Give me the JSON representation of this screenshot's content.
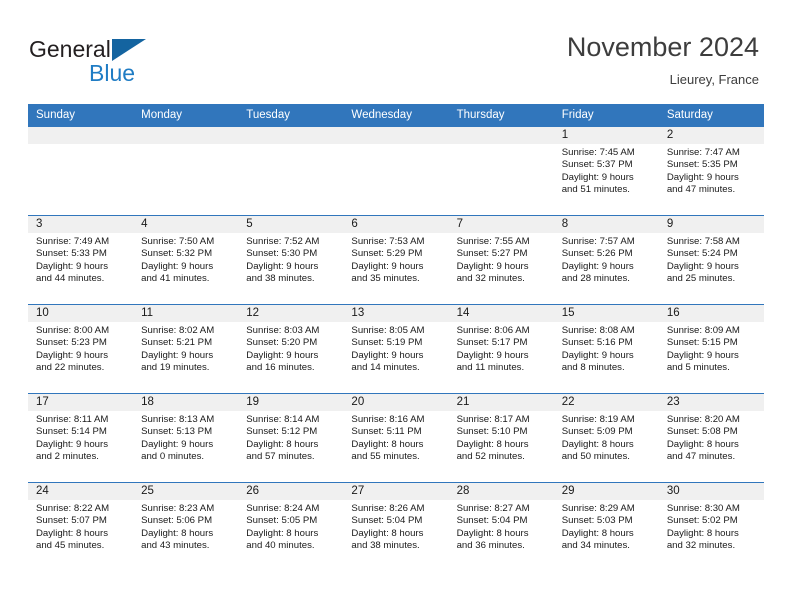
{
  "brand": {
    "name_part1": "General",
    "name_part2": "Blue",
    "triangle_icon": "blue-triangle-logo-icon",
    "accent_color": "#1f7cc4",
    "logo_triangle_color": "#1464a0"
  },
  "header": {
    "title": "November 2024",
    "location": "Lieurey, France"
  },
  "grid": {
    "header_bg": "#3176bc",
    "header_text_color": "#ffffff",
    "daynum_band_bg": "#f0f0f0",
    "weekdays": [
      "Sunday",
      "Monday",
      "Tuesday",
      "Wednesday",
      "Thursday",
      "Friday",
      "Saturday"
    ]
  },
  "weeks": [
    [
      {
        "empty": true
      },
      {
        "empty": true
      },
      {
        "empty": true
      },
      {
        "empty": true
      },
      {
        "empty": true
      },
      {
        "empty": false,
        "day": "1",
        "sunrise": "Sunrise: 7:45 AM",
        "sunset": "Sunset: 5:37 PM",
        "daylight_line1": "Daylight: 9 hours",
        "daylight_line2": "and 51 minutes."
      },
      {
        "empty": false,
        "day": "2",
        "sunrise": "Sunrise: 7:47 AM",
        "sunset": "Sunset: 5:35 PM",
        "daylight_line1": "Daylight: 9 hours",
        "daylight_line2": "and 47 minutes."
      }
    ],
    [
      {
        "empty": false,
        "day": "3",
        "sunrise": "Sunrise: 7:49 AM",
        "sunset": "Sunset: 5:33 PM",
        "daylight_line1": "Daylight: 9 hours",
        "daylight_line2": "and 44 minutes."
      },
      {
        "empty": false,
        "day": "4",
        "sunrise": "Sunrise: 7:50 AM",
        "sunset": "Sunset: 5:32 PM",
        "daylight_line1": "Daylight: 9 hours",
        "daylight_line2": "and 41 minutes."
      },
      {
        "empty": false,
        "day": "5",
        "sunrise": "Sunrise: 7:52 AM",
        "sunset": "Sunset: 5:30 PM",
        "daylight_line1": "Daylight: 9 hours",
        "daylight_line2": "and 38 minutes."
      },
      {
        "empty": false,
        "day": "6",
        "sunrise": "Sunrise: 7:53 AM",
        "sunset": "Sunset: 5:29 PM",
        "daylight_line1": "Daylight: 9 hours",
        "daylight_line2": "and 35 minutes."
      },
      {
        "empty": false,
        "day": "7",
        "sunrise": "Sunrise: 7:55 AM",
        "sunset": "Sunset: 5:27 PM",
        "daylight_line1": "Daylight: 9 hours",
        "daylight_line2": "and 32 minutes."
      },
      {
        "empty": false,
        "day": "8",
        "sunrise": "Sunrise: 7:57 AM",
        "sunset": "Sunset: 5:26 PM",
        "daylight_line1": "Daylight: 9 hours",
        "daylight_line2": "and 28 minutes."
      },
      {
        "empty": false,
        "day": "9",
        "sunrise": "Sunrise: 7:58 AM",
        "sunset": "Sunset: 5:24 PM",
        "daylight_line1": "Daylight: 9 hours",
        "daylight_line2": "and 25 minutes."
      }
    ],
    [
      {
        "empty": false,
        "day": "10",
        "sunrise": "Sunrise: 8:00 AM",
        "sunset": "Sunset: 5:23 PM",
        "daylight_line1": "Daylight: 9 hours",
        "daylight_line2": "and 22 minutes."
      },
      {
        "empty": false,
        "day": "11",
        "sunrise": "Sunrise: 8:02 AM",
        "sunset": "Sunset: 5:21 PM",
        "daylight_line1": "Daylight: 9 hours",
        "daylight_line2": "and 19 minutes."
      },
      {
        "empty": false,
        "day": "12",
        "sunrise": "Sunrise: 8:03 AM",
        "sunset": "Sunset: 5:20 PM",
        "daylight_line1": "Daylight: 9 hours",
        "daylight_line2": "and 16 minutes."
      },
      {
        "empty": false,
        "day": "13",
        "sunrise": "Sunrise: 8:05 AM",
        "sunset": "Sunset: 5:19 PM",
        "daylight_line1": "Daylight: 9 hours",
        "daylight_line2": "and 14 minutes."
      },
      {
        "empty": false,
        "day": "14",
        "sunrise": "Sunrise: 8:06 AM",
        "sunset": "Sunset: 5:17 PM",
        "daylight_line1": "Daylight: 9 hours",
        "daylight_line2": "and 11 minutes."
      },
      {
        "empty": false,
        "day": "15",
        "sunrise": "Sunrise: 8:08 AM",
        "sunset": "Sunset: 5:16 PM",
        "daylight_line1": "Daylight: 9 hours",
        "daylight_line2": "and 8 minutes."
      },
      {
        "empty": false,
        "day": "16",
        "sunrise": "Sunrise: 8:09 AM",
        "sunset": "Sunset: 5:15 PM",
        "daylight_line1": "Daylight: 9 hours",
        "daylight_line2": "and 5 minutes."
      }
    ],
    [
      {
        "empty": false,
        "day": "17",
        "sunrise": "Sunrise: 8:11 AM",
        "sunset": "Sunset: 5:14 PM",
        "daylight_line1": "Daylight: 9 hours",
        "daylight_line2": "and 2 minutes."
      },
      {
        "empty": false,
        "day": "18",
        "sunrise": "Sunrise: 8:13 AM",
        "sunset": "Sunset: 5:13 PM",
        "daylight_line1": "Daylight: 9 hours",
        "daylight_line2": "and 0 minutes."
      },
      {
        "empty": false,
        "day": "19",
        "sunrise": "Sunrise: 8:14 AM",
        "sunset": "Sunset: 5:12 PM",
        "daylight_line1": "Daylight: 8 hours",
        "daylight_line2": "and 57 minutes."
      },
      {
        "empty": false,
        "day": "20",
        "sunrise": "Sunrise: 8:16 AM",
        "sunset": "Sunset: 5:11 PM",
        "daylight_line1": "Daylight: 8 hours",
        "daylight_line2": "and 55 minutes."
      },
      {
        "empty": false,
        "day": "21",
        "sunrise": "Sunrise: 8:17 AM",
        "sunset": "Sunset: 5:10 PM",
        "daylight_line1": "Daylight: 8 hours",
        "daylight_line2": "and 52 minutes."
      },
      {
        "empty": false,
        "day": "22",
        "sunrise": "Sunrise: 8:19 AM",
        "sunset": "Sunset: 5:09 PM",
        "daylight_line1": "Daylight: 8 hours",
        "daylight_line2": "and 50 minutes."
      },
      {
        "empty": false,
        "day": "23",
        "sunrise": "Sunrise: 8:20 AM",
        "sunset": "Sunset: 5:08 PM",
        "daylight_line1": "Daylight: 8 hours",
        "daylight_line2": "and 47 minutes."
      }
    ],
    [
      {
        "empty": false,
        "day": "24",
        "sunrise": "Sunrise: 8:22 AM",
        "sunset": "Sunset: 5:07 PM",
        "daylight_line1": "Daylight: 8 hours",
        "daylight_line2": "and 45 minutes."
      },
      {
        "empty": false,
        "day": "25",
        "sunrise": "Sunrise: 8:23 AM",
        "sunset": "Sunset: 5:06 PM",
        "daylight_line1": "Daylight: 8 hours",
        "daylight_line2": "and 43 minutes."
      },
      {
        "empty": false,
        "day": "26",
        "sunrise": "Sunrise: 8:24 AM",
        "sunset": "Sunset: 5:05 PM",
        "daylight_line1": "Daylight: 8 hours",
        "daylight_line2": "and 40 minutes."
      },
      {
        "empty": false,
        "day": "27",
        "sunrise": "Sunrise: 8:26 AM",
        "sunset": "Sunset: 5:04 PM",
        "daylight_line1": "Daylight: 8 hours",
        "daylight_line2": "and 38 minutes."
      },
      {
        "empty": false,
        "day": "28",
        "sunrise": "Sunrise: 8:27 AM",
        "sunset": "Sunset: 5:04 PM",
        "daylight_line1": "Daylight: 8 hours",
        "daylight_line2": "and 36 minutes."
      },
      {
        "empty": false,
        "day": "29",
        "sunrise": "Sunrise: 8:29 AM",
        "sunset": "Sunset: 5:03 PM",
        "daylight_line1": "Daylight: 8 hours",
        "daylight_line2": "and 34 minutes."
      },
      {
        "empty": false,
        "day": "30",
        "sunrise": "Sunrise: 8:30 AM",
        "sunset": "Sunset: 5:02 PM",
        "daylight_line1": "Daylight: 8 hours",
        "daylight_line2": "and 32 minutes."
      }
    ]
  ]
}
